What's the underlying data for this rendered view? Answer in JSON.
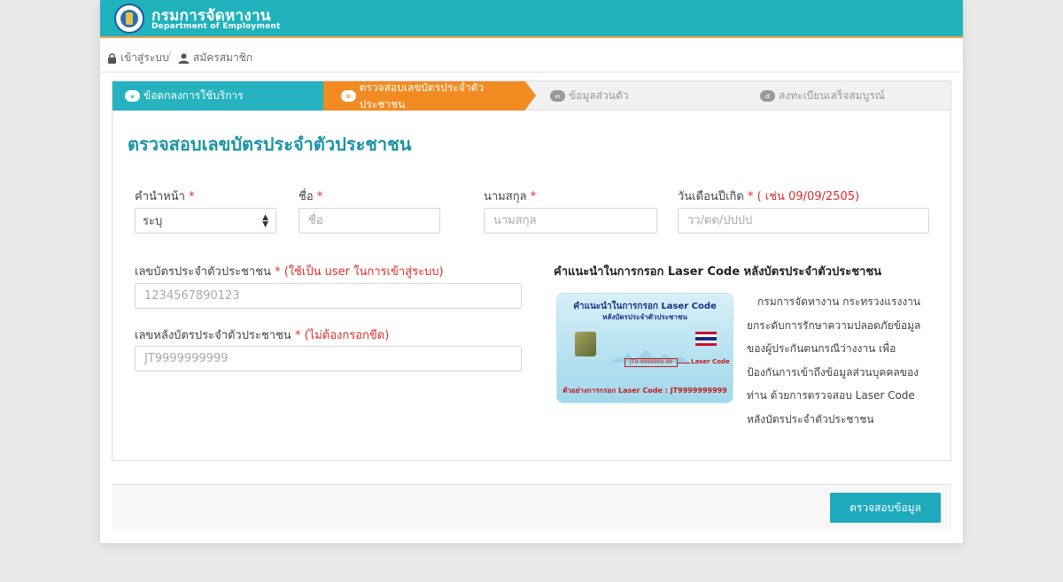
{
  "header": {
    "title_th": "กรมการจัดหางาน",
    "title_en": "Department of Employment"
  },
  "breadcrumb": {
    "login_label": "เข้าสู่ระบบ",
    "separator": "/",
    "register_label": "สมัครสมาชิก"
  },
  "steps": [
    {
      "num": "๑",
      "label": "ข้อตกลงการใช้บริการ",
      "state": "done"
    },
    {
      "num": "๒",
      "label": "ตรวจสอบเลขบัตรประจำตัวประชาชน",
      "state": "active"
    },
    {
      "num": "๓",
      "label": "ข้อมูลส่วนตัว",
      "state": "pending"
    },
    {
      "num": "๔",
      "label": "ลงทะเบียนเสร็จสมบูรณ์",
      "state": "pending"
    }
  ],
  "form": {
    "title": "ตรวจสอบเลขบัตรประจำตัวประชาชน",
    "prefix_label": "คำนำหน้า",
    "prefix_value": "ระบุ",
    "firstname_label": "ชื่อ",
    "firstname_placeholder": "ชื่อ",
    "lastname_label": "นามสกุล",
    "lastname_placeholder": "นามสกุล",
    "birthdate_label": "วันเดือนปีเกิด",
    "birthdate_hint": "( เช่น 09/09/2505)",
    "birthdate_placeholder": "วว/ดด/ปปปป",
    "idcard_label": "เลขบัตรประจำตัวประชาชน",
    "idcard_hint": "(ใช้เป็น user ในการเข้าสู่ระบบ)",
    "idcard_placeholder": "1234567890123",
    "laser_label": "เลขหลังบัตรประจำตัวประชาชน",
    "laser_hint": "(ไม่ต้องกรอกขีด)",
    "laser_placeholder": "JT9999999999",
    "required_mark": "*"
  },
  "info": {
    "title": "คำแนะนำในการกรอก Laser Code หลังบัตรประจำตัวประชาชน",
    "card_title": "คำแนะนำในการกรอก Laser Code",
    "card_subtitle": "หลังบัตรประจำตัวประชาชน",
    "card_code_sample": "JT9-9999999-99",
    "card_code_label": "Laser Code",
    "card_example": "ตัวอย่างการกรอก Laser Code : JT9999999999",
    "description": "กรมการจัดหางาน กระทรวงแรงงาน ยกระดับการรักษาความปลอดภัยข้อมูลของผู้ประกันตนกรณีว่างงาน เพื่อป้องกันการเข้าถึงข้อมูลส่วนบุคคลของท่าน ด้วยการตรวจสอบ Laser Code หลังบัตรประจำตัวประชาชน"
  },
  "actions": {
    "submit_label": "ตรวจสอบข้อมูล"
  },
  "colors": {
    "brand_teal": "#20b2bd",
    "active_orange": "#f28c22",
    "required_red": "#e02b2b"
  }
}
